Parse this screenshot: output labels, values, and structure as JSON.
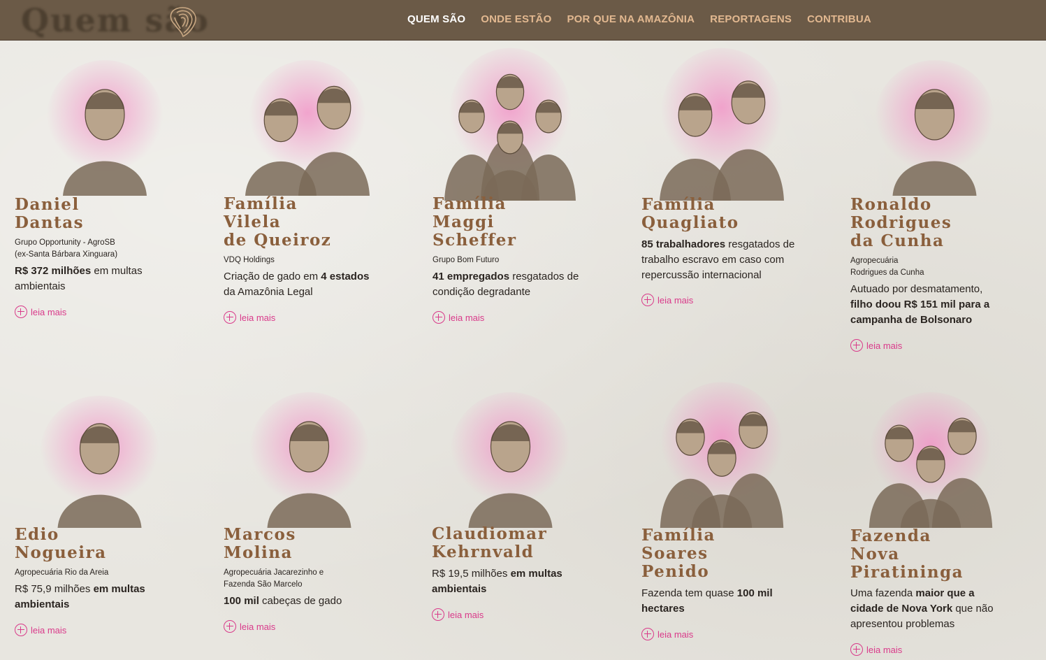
{
  "header": {
    "ghost_title": "Quem são",
    "logo_icon": "brazil-map-fingerprint-icon",
    "menu": [
      {
        "label": "QUEM SÃO",
        "active": true
      },
      {
        "label": "ONDE ESTÃO",
        "active": false
      },
      {
        "label": "POR QUE NA AMAZÔNIA",
        "active": false
      },
      {
        "label": "REPORTAGENS",
        "active": false
      },
      {
        "label": "CONTRIBUA",
        "active": false
      }
    ]
  },
  "colors": {
    "nav_bg": "#6b5a47",
    "name": "#8a5f3c",
    "accent_pink": "#d93a8a",
    "menu_active": "#ffffff",
    "menu_inactive": "#e2b890"
  },
  "read_more_label": "leia mais",
  "cards": [
    {
      "name_lines": [
        "Daniel",
        "Dantas"
      ],
      "org_lines": [
        "Grupo Opportunity - AgroSB",
        "(ex-Santa Bárbara Xinguara)"
      ],
      "desc": [
        {
          "b": true,
          "t": "R$ 372 milhões"
        },
        {
          "b": false,
          "t": " em multas ambientais"
        }
      ]
    },
    {
      "name_lines": [
        "Família",
        "Vilela",
        "de Queiroz"
      ],
      "org_lines": [
        "VDQ Holdings"
      ],
      "desc": [
        {
          "b": false,
          "t": "Criação de gado em "
        },
        {
          "b": true,
          "t": "4 estados"
        },
        {
          "b": false,
          "t": " da Amazônia Legal"
        }
      ]
    },
    {
      "name_lines": [
        "Família",
        "Maggi",
        "Scheffer"
      ],
      "org_lines": [
        "Grupo Bom Futuro"
      ],
      "desc": [
        {
          "b": true,
          "t": "41 empregados"
        },
        {
          "b": false,
          "t": " resgatados de condição degradante"
        }
      ]
    },
    {
      "name_lines": [
        "Família",
        "Quagliato"
      ],
      "org_lines": [],
      "desc": [
        {
          "b": true,
          "t": "85 trabalhadores"
        },
        {
          "b": false,
          "t": " resgatados de trabalho escravo em caso com repercussão internacional"
        }
      ]
    },
    {
      "name_lines": [
        "Ronaldo",
        "Rodrigues",
        "da Cunha"
      ],
      "org_lines": [
        "Agropecuária",
        "Rodrigues da Cunha"
      ],
      "desc": [
        {
          "b": false,
          "t": "Autuado por desmatamento, "
        },
        {
          "b": true,
          "t": "filho doou R$ 151 mil para a campanha de Bolsonaro"
        }
      ]
    },
    {
      "name_lines": [
        "Edio",
        "Nogueira"
      ],
      "org_lines": [
        "Agropecuária Rio da Areia"
      ],
      "desc": [
        {
          "b": false,
          "t": "R$ 75,9 milhões "
        },
        {
          "b": true,
          "t": "em multas ambientais"
        }
      ]
    },
    {
      "name_lines": [
        "Marcos",
        "Molina"
      ],
      "org_lines": [
        "Agropecuária Jacarezinho e",
        "Fazenda São Marcelo"
      ],
      "desc": [
        {
          "b": true,
          "t": "100 mil"
        },
        {
          "b": false,
          "t": " cabeças de gado"
        }
      ]
    },
    {
      "name_lines": [
        "Claudiomar",
        "Kehrnvald"
      ],
      "org_lines": [],
      "desc": [
        {
          "b": false,
          "t": "R$ 19,5 milhões "
        },
        {
          "b": true,
          "t": "em multas ambientais"
        }
      ]
    },
    {
      "name_lines": [
        "Família",
        "Soares",
        "Penido"
      ],
      "org_lines": [],
      "desc": [
        {
          "b": false,
          "t": "Fazenda tem quase "
        },
        {
          "b": true,
          "t": "100 mil hectares"
        }
      ]
    },
    {
      "name_lines": [
        "Fazenda",
        "Nova",
        "Piratininga"
      ],
      "org_lines": [],
      "desc": [
        {
          "b": false,
          "t": "Uma fazenda "
        },
        {
          "b": true,
          "t": "maior que a cidade de Nova York"
        },
        {
          "b": false,
          "t": " que não apresentou problemas"
        }
      ]
    }
  ]
}
